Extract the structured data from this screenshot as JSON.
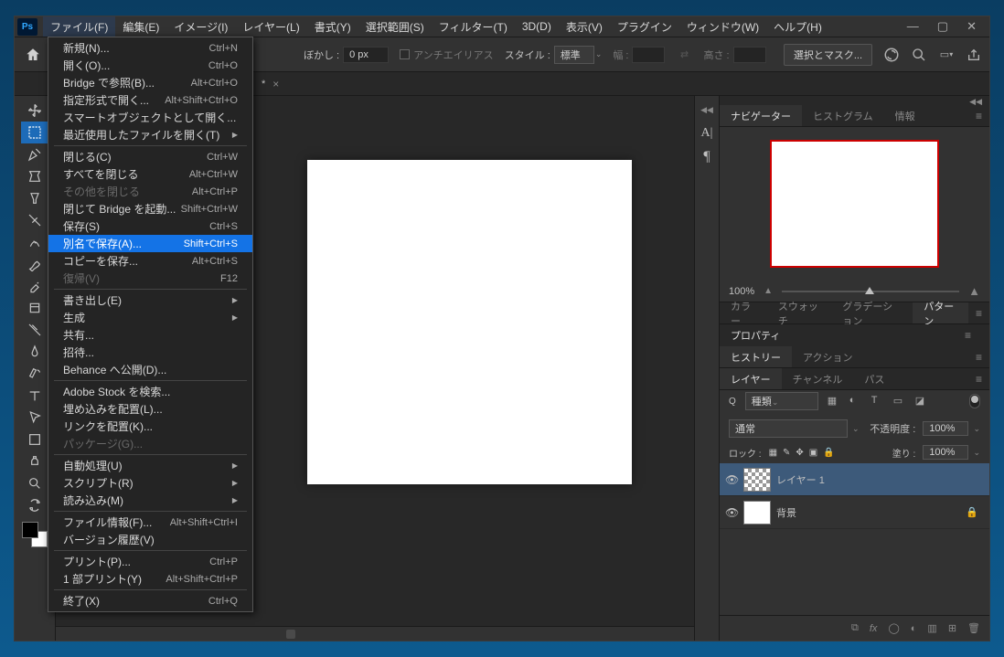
{
  "menubar": {
    "items": [
      "ファイル(F)",
      "編集(E)",
      "イメージ(I)",
      "レイヤー(L)",
      "書式(Y)",
      "選択範囲(S)",
      "フィルター(T)",
      "3D(D)",
      "表示(V)",
      "プラグイン",
      "ウィンドウ(W)",
      "ヘルプ(H)"
    ]
  },
  "options_bar": {
    "feather_label": "ぼかし :",
    "feather_value": "0 px",
    "antialias": "アンチエイリアス",
    "style_label": "スタイル :",
    "style_value": "標準",
    "width_label": "幅 :",
    "height_label": "高さ :",
    "mask_button": "選択とマスク..."
  },
  "doc_tab": {
    "title": "*"
  },
  "file_menu": {
    "groups": [
      [
        {
          "label": "新規(N)...",
          "shortcut": "Ctrl+N"
        },
        {
          "label": "開く(O)...",
          "shortcut": "Ctrl+O"
        },
        {
          "label": "Bridge で参照(B)...",
          "shortcut": "Alt+Ctrl+O"
        },
        {
          "label": "指定形式で開く...",
          "shortcut": "Alt+Shift+Ctrl+O"
        },
        {
          "label": "スマートオブジェクトとして開く..."
        },
        {
          "label": "最近使用したファイルを開く(T)",
          "submenu": true
        }
      ],
      [
        {
          "label": "閉じる(C)",
          "shortcut": "Ctrl+W"
        },
        {
          "label": "すべてを閉じる",
          "shortcut": "Alt+Ctrl+W"
        },
        {
          "label": "その他を閉じる",
          "shortcut": "Alt+Ctrl+P",
          "disabled": true
        },
        {
          "label": "閉じて Bridge を起動...",
          "shortcut": "Shift+Ctrl+W"
        },
        {
          "label": "保存(S)",
          "shortcut": "Ctrl+S"
        },
        {
          "label": "別名で保存(A)...",
          "shortcut": "Shift+Ctrl+S",
          "selected": true
        },
        {
          "label": "コピーを保存...",
          "shortcut": "Alt+Ctrl+S"
        },
        {
          "label": "復帰(V)",
          "shortcut": "F12",
          "disabled": true
        }
      ],
      [
        {
          "label": "書き出し(E)",
          "submenu": true
        },
        {
          "label": "生成",
          "submenu": true
        },
        {
          "label": "共有..."
        },
        {
          "label": "招待..."
        },
        {
          "label": "Behance へ公開(D)..."
        }
      ],
      [
        {
          "label": "Adobe Stock を検索..."
        },
        {
          "label": "埋め込みを配置(L)..."
        },
        {
          "label": "リンクを配置(K)..."
        },
        {
          "label": "パッケージ(G)...",
          "disabled": true
        }
      ],
      [
        {
          "label": "自動処理(U)",
          "submenu": true
        },
        {
          "label": "スクリプト(R)",
          "submenu": true
        },
        {
          "label": "読み込み(M)",
          "submenu": true
        }
      ],
      [
        {
          "label": "ファイル情報(F)...",
          "shortcut": "Alt+Shift+Ctrl+I"
        },
        {
          "label": "バージョン履歴(V)"
        }
      ],
      [
        {
          "label": "プリント(P)...",
          "shortcut": "Ctrl+P"
        },
        {
          "label": "1 部プリント(Y)",
          "shortcut": "Alt+Shift+Ctrl+P"
        }
      ],
      [
        {
          "label": "終了(X)",
          "shortcut": "Ctrl+Q"
        }
      ]
    ]
  },
  "panels": {
    "navigator_tabs": [
      "ナビゲーター",
      "ヒストグラム",
      "情報"
    ],
    "zoom_value": "100%",
    "color_tabs": [
      "カラー",
      "スウォッチ",
      "グラデーション",
      "パターン"
    ],
    "color_active_idx": 3,
    "properties_tab": "プロパティ",
    "history_tabs": [
      "ヒストリー",
      "アクション"
    ],
    "layers_tabs": [
      "レイヤー",
      "チャンネル",
      "パス"
    ],
    "layer_filter_value": "種類",
    "blend_mode": "通常",
    "opacity_label": "不透明度 :",
    "opacity_value": "100%",
    "lock_label": "ロック :",
    "fill_label": "塗り :",
    "fill_value": "100%",
    "layers": [
      {
        "name": "レイヤー 1",
        "checker": true
      },
      {
        "name": "背景",
        "checker": false
      }
    ]
  }
}
